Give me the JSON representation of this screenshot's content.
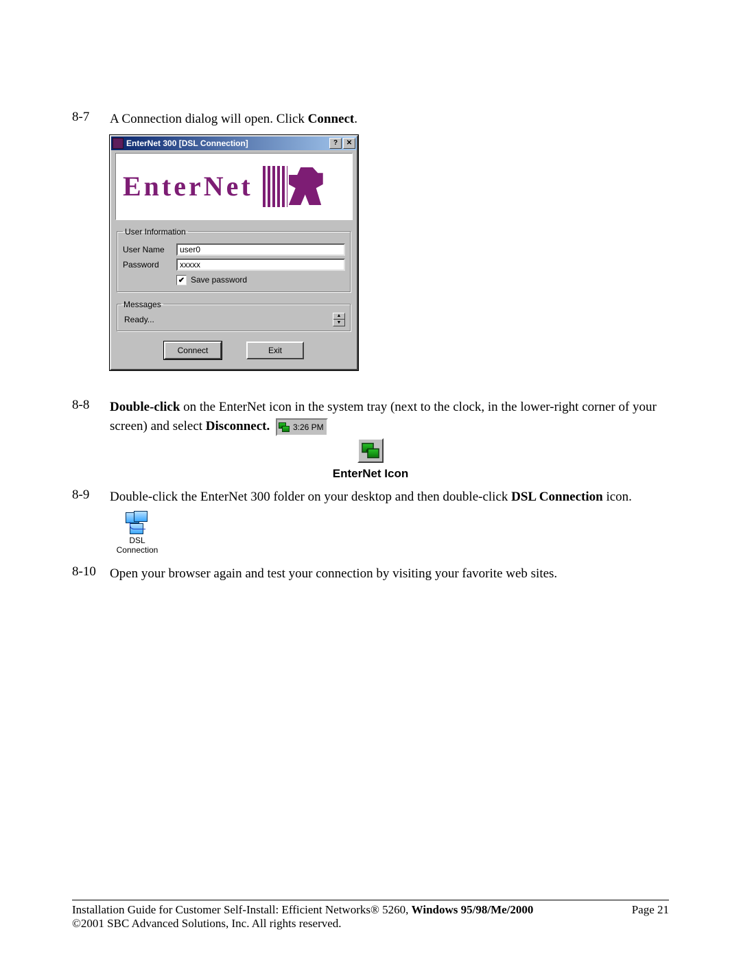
{
  "steps": {
    "s87": {
      "num": "8-7",
      "text_a": "A Connection dialog will open.  Click ",
      "bold_a": "Connect",
      "text_b": "."
    },
    "s88": {
      "num": "8-8",
      "bold_a": "Double-click",
      "text_a": " on the EnterNet icon in the system tray (next to the clock, in the lower-right corner of your screen) and select ",
      "bold_b": "Disconnect.",
      "text_b": " "
    },
    "s89": {
      "num": "8-9",
      "text_a": "Double-click the EnterNet 300 folder on your desktop and then double-click ",
      "bold_a": "DSL Connection",
      "text_b": " icon."
    },
    "s810": {
      "num": "8-10",
      "text_a": "Open your browser again and test your connection by visiting your favorite web sites."
    }
  },
  "dialog": {
    "title": "EnterNet 300 [DSL Connection]",
    "help_btn": "?",
    "close_btn": "✕",
    "logo_text": "EnterNet",
    "user_info_legend": "User Information",
    "username_label": "User Name",
    "username_value": "user0",
    "password_label": "Password",
    "password_value": "xxxxx",
    "save_password_label": "Save password",
    "save_password_checked": "✔",
    "messages_legend": "Messages",
    "messages_text": "Ready...",
    "connect_label": "Connect",
    "exit_label": "Exit"
  },
  "tray": {
    "time": "3:26 PM"
  },
  "enternet_icon_caption": "EnterNet Icon",
  "shortcut": {
    "line1": "DSL",
    "line2": "Connection"
  },
  "footer": {
    "line1_a": "Installation Guide for Customer Self-Install: Efficient Networks® 5260, ",
    "line1_bold": "Windows 95/98/Me/2000",
    "line2": "©2001 SBC Advanced Solutions, Inc.  All rights reserved.",
    "page_label": "Page 21"
  }
}
